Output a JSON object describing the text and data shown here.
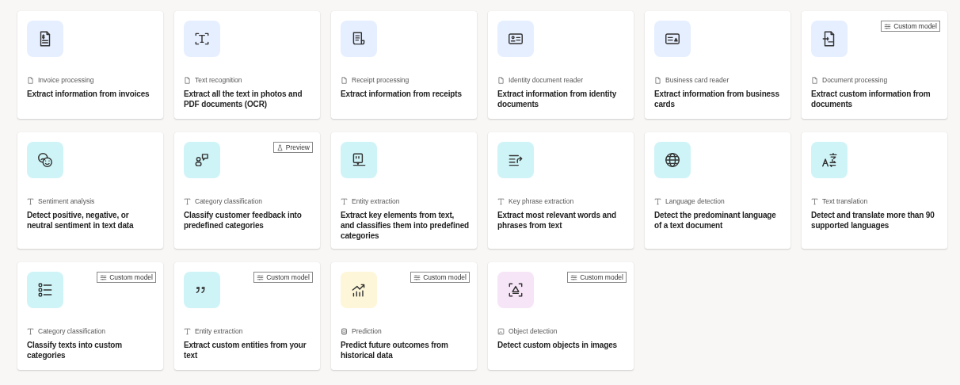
{
  "cards": [
    {
      "color": "#e6efff",
      "kind": "document",
      "category": "Invoice processing",
      "description": "Extract information from invoices"
    },
    {
      "color": "#e6efff",
      "kind": "document",
      "category": "Text recognition",
      "description": "Extract all the text in photos and PDF documents (OCR)"
    },
    {
      "color": "#e6efff",
      "kind": "document",
      "category": "Receipt processing",
      "description": "Extract information from receipts"
    },
    {
      "color": "#e6efff",
      "kind": "document",
      "category": "Identity document reader",
      "description": "Extract information from identity documents"
    },
    {
      "color": "#e6efff",
      "kind": "document",
      "category": "Business card reader",
      "description": "Extract information from business cards"
    },
    {
      "color": "#e6efff",
      "kind": "document",
      "category": "Document processing",
      "description": "Extract custom information from documents",
      "badge": {
        "kind": "custom",
        "label": "Custom model"
      }
    },
    {
      "color": "#cff4f7",
      "kind": "text",
      "category": "Sentiment analysis",
      "description": "Detect positive, negative, or neutral sentiment in text data"
    },
    {
      "color": "#cff4f7",
      "kind": "text",
      "category": "Category classification",
      "description": "Classify customer feedback into predefined categories",
      "badge": {
        "kind": "preview",
        "label": "Preview"
      }
    },
    {
      "color": "#cff4f7",
      "kind": "text",
      "category": "Entity extraction",
      "description": "Extract key elements from text, and classifies them into predefined categories"
    },
    {
      "color": "#cff4f7",
      "kind": "text",
      "category": "Key phrase extraction",
      "description": "Extract most relevant words and phrases from text"
    },
    {
      "color": "#cff4f7",
      "kind": "text",
      "category": "Language detection",
      "description": "Detect the predominant language of a text document"
    },
    {
      "color": "#cff4f7",
      "kind": "text",
      "category": "Text translation",
      "description": "Detect and translate more than 90 supported languages"
    },
    {
      "color": "#cff4f7",
      "kind": "text",
      "category": "Category classification",
      "description": "Classify texts into custom categories",
      "badge": {
        "kind": "custom",
        "label": "Custom model"
      }
    },
    {
      "color": "#cff4f7",
      "kind": "text",
      "category": "Entity extraction",
      "description": "Extract custom entities from your text",
      "badge": {
        "kind": "custom",
        "label": "Custom model"
      }
    },
    {
      "color": "#fdf6d8",
      "kind": "database",
      "category": "Prediction",
      "description": "Predict future outcomes from historical data",
      "badge": {
        "kind": "custom",
        "label": "Custom model"
      }
    },
    {
      "color": "#f6e4f7",
      "kind": "image",
      "category": "Object detection",
      "description": "Detect custom objects in images",
      "badge": {
        "kind": "custom",
        "label": "Custom model"
      }
    }
  ]
}
